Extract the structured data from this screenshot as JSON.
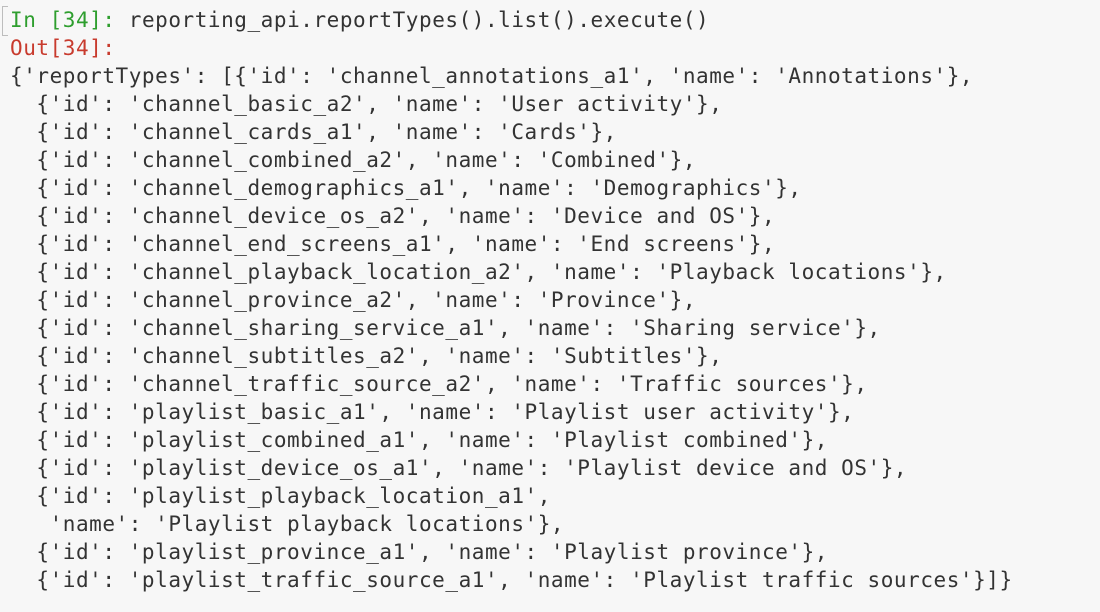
{
  "cell": {
    "in_prompt": "In [34]:",
    "code": "reporting_api.reportTypes().list().execute()",
    "out_prompt": "Out[34]:"
  },
  "output_lines": [
    "{'reportTypes': [{'id': 'channel_annotations_a1', 'name': 'Annotations'},",
    "  {'id': 'channel_basic_a2', 'name': 'User activity'},",
    "  {'id': 'channel_cards_a1', 'name': 'Cards'},",
    "  {'id': 'channel_combined_a2', 'name': 'Combined'},",
    "  {'id': 'channel_demographics_a1', 'name': 'Demographics'},",
    "  {'id': 'channel_device_os_a2', 'name': 'Device and OS'},",
    "  {'id': 'channel_end_screens_a1', 'name': 'End screens'},",
    "  {'id': 'channel_playback_location_a2', 'name': 'Playback locations'},",
    "  {'id': 'channel_province_a2', 'name': 'Province'},",
    "  {'id': 'channel_sharing_service_a1', 'name': 'Sharing service'},",
    "  {'id': 'channel_subtitles_a2', 'name': 'Subtitles'},",
    "  {'id': 'channel_traffic_source_a2', 'name': 'Traffic sources'},",
    "  {'id': 'playlist_basic_a1', 'name': 'Playlist user activity'},",
    "  {'id': 'playlist_combined_a1', 'name': 'Playlist combined'},",
    "  {'id': 'playlist_device_os_a1', 'name': 'Playlist device and OS'},",
    "  {'id': 'playlist_playback_location_a1',",
    "   'name': 'Playlist playback locations'},",
    "  {'id': 'playlist_province_a1', 'name': 'Playlist province'},",
    "  {'id': 'playlist_traffic_source_a1', 'name': 'Playlist traffic sources'}]}"
  ],
  "colors": {
    "background": "#f7f7f7",
    "text": "#333333",
    "in_prompt": "#2e9e2e",
    "out_prompt": "#c83b2e"
  }
}
